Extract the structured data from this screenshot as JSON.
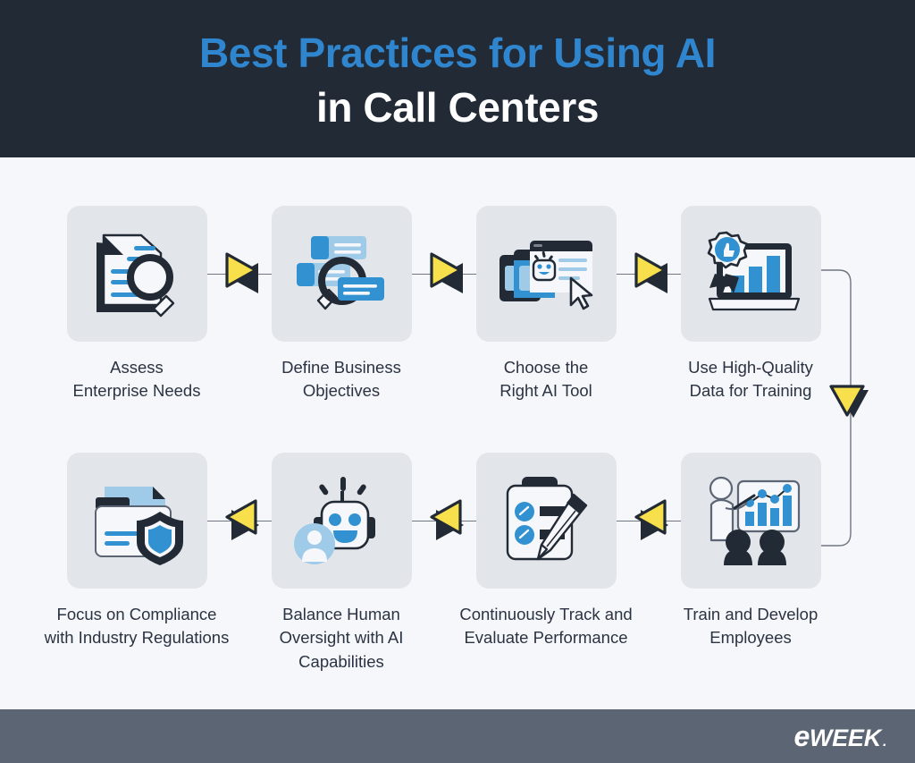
{
  "header": {
    "title_line1": "Best Practices for Using AI",
    "title_line2": "in Call Centers",
    "title_color_line1": "#2f86cf",
    "title_color_line2": "#ffffff",
    "background": "#222a35"
  },
  "theme": {
    "page_background": "#f5f7fa",
    "tile_background": "#e2e5ea",
    "accent_blue": "#3291d0",
    "light_blue": "#9fcbe8",
    "dark_navy": "#222a35",
    "arrow_yellow": "#f7e04b",
    "connector_line": "#6f7785",
    "text_color": "#2b3342",
    "footer_background": "#5b6573"
  },
  "steps": [
    {
      "index": 1,
      "label": "Assess\nEnterprise Needs",
      "icon": "document-magnifier-icon"
    },
    {
      "index": 2,
      "label": "Define Business\nObjectives",
      "icon": "cards-magnifier-icon"
    },
    {
      "index": 3,
      "label": "Choose the\nRight AI Tool",
      "icon": "ai-windows-cursor-icon"
    },
    {
      "index": 4,
      "label": "Use High-Quality\nData for Training",
      "icon": "laptop-chart-badge-icon"
    },
    {
      "index": 5,
      "label": "Train and Develop\nEmployees",
      "icon": "training-presentation-icon"
    },
    {
      "index": 6,
      "label": "Continuously Track and\nEvaluate Performance",
      "icon": "clipboard-pencil-icon"
    },
    {
      "index": 7,
      "label": "Balance Human\nOversight with AI\nCapabilities",
      "icon": "robot-human-icon"
    },
    {
      "index": 8,
      "label": "Focus on Compliance\nwith Industry Regulations",
      "icon": "folder-shield-icon"
    }
  ],
  "connectors": [
    {
      "name": "arrow-1-to-2",
      "direction": "right"
    },
    {
      "name": "arrow-2-to-3",
      "direction": "right"
    },
    {
      "name": "arrow-3-to-4",
      "direction": "right"
    },
    {
      "name": "arrow-4-to-5",
      "direction": "down"
    },
    {
      "name": "arrow-5-to-6",
      "direction": "left"
    },
    {
      "name": "arrow-6-to-7",
      "direction": "left"
    },
    {
      "name": "arrow-7-to-8",
      "direction": "left"
    }
  ],
  "footer": {
    "logo_e": "e",
    "logo_week": "WEEK",
    "logo_dot": "."
  }
}
